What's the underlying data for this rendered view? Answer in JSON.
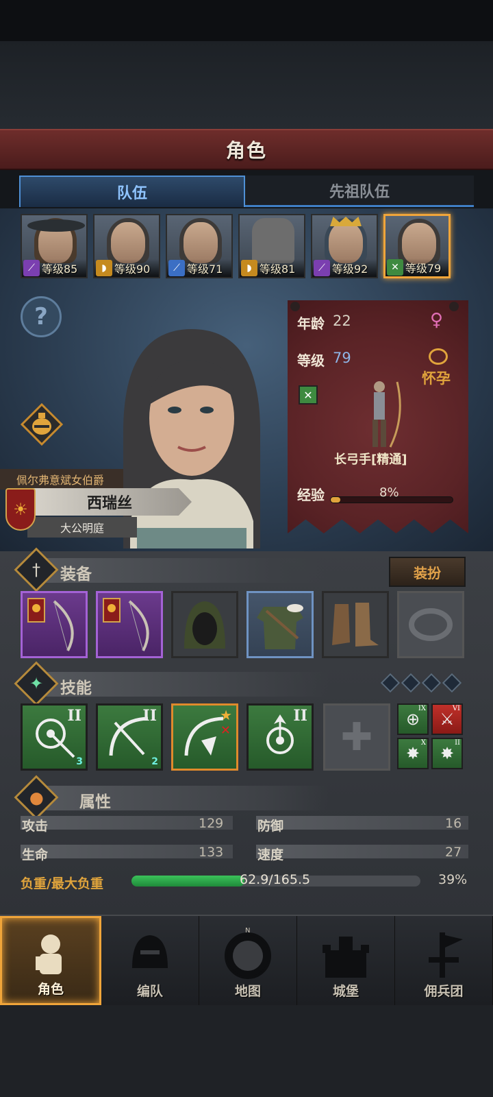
{
  "header": {
    "title": "角色"
  },
  "tabs": [
    {
      "label": "队伍",
      "active": true
    },
    {
      "label": "先祖队伍",
      "active": false
    }
  ],
  "team": [
    {
      "level_text": "等级85",
      "class_color": "#7b3fb0",
      "class_icon": "staff-icon"
    },
    {
      "level_text": "等级90",
      "class_color": "#c58a1f",
      "class_icon": "shield-icon"
    },
    {
      "level_text": "等级71",
      "class_color": "#3b6fc4",
      "class_icon": "sword-icon"
    },
    {
      "level_text": "等级81",
      "class_color": "#c58a1f",
      "class_icon": "shield-icon"
    },
    {
      "level_text": "等级92",
      "class_color": "#7b3fb0",
      "class_icon": "staff-icon"
    },
    {
      "level_text": "等级79",
      "class_color": "#3e8a40",
      "class_icon": "bow-icon",
      "selected": true
    }
  ],
  "character": {
    "title": "佩尔弗意斌女伯爵",
    "name": "西瑞丝",
    "court": "大公明庭"
  },
  "info": {
    "age_label": "年龄",
    "age_value": "22",
    "level_label": "等级",
    "level_value": "79",
    "status": "怀孕",
    "class_name": "长弓手[精通]",
    "exp_label": "经验",
    "exp_percent": "8%",
    "exp_fraction": 0.08
  },
  "equipment": {
    "title": "装备",
    "outfit_button": "装扮",
    "slots": [
      {
        "name": "bow-slot-1",
        "rarity": "purple"
      },
      {
        "name": "bow-slot-2",
        "rarity": "purple"
      },
      {
        "name": "hood-slot",
        "rarity": "none"
      },
      {
        "name": "armor-slot",
        "rarity": "blue"
      },
      {
        "name": "boots-slot",
        "rarity": "none"
      },
      {
        "name": "ring-slot",
        "rarity": "empty"
      }
    ]
  },
  "skills": {
    "title": "技能",
    "slots": [
      {
        "rank": "II",
        "badge": "3"
      },
      {
        "rank": "II",
        "badge": "2"
      },
      {
        "rank": "",
        "badge": ""
      },
      {
        "rank": "II",
        "badge": ""
      }
    ],
    "mini": [
      {
        "rank": "IX"
      },
      {
        "rank": "VI"
      },
      {
        "rank": "X"
      },
      {
        "rank": "II"
      }
    ]
  },
  "attributes": {
    "title": "属性",
    "attack_label": "攻击",
    "attack_value": "129",
    "defense_label": "防御",
    "defense_value": "16",
    "hp_label": "生命",
    "hp_value": "133",
    "speed_label": "速度",
    "speed_value": "27",
    "load_label": "负重/最大负重",
    "load_value": "62.9/165.5",
    "load_percent": "39%",
    "load_fraction": 0.39
  },
  "nav": [
    {
      "label": "角色",
      "active": true
    },
    {
      "label": "编队",
      "active": false
    },
    {
      "label": "地图",
      "active": false
    },
    {
      "label": "城堡",
      "active": false
    },
    {
      "label": "佣兵团",
      "active": false
    }
  ],
  "colors": {
    "accent": "#f0a53a",
    "tab_blue": "#4f90d6",
    "header_red": "#6e2d2b",
    "load_green": "#2ea84a"
  }
}
